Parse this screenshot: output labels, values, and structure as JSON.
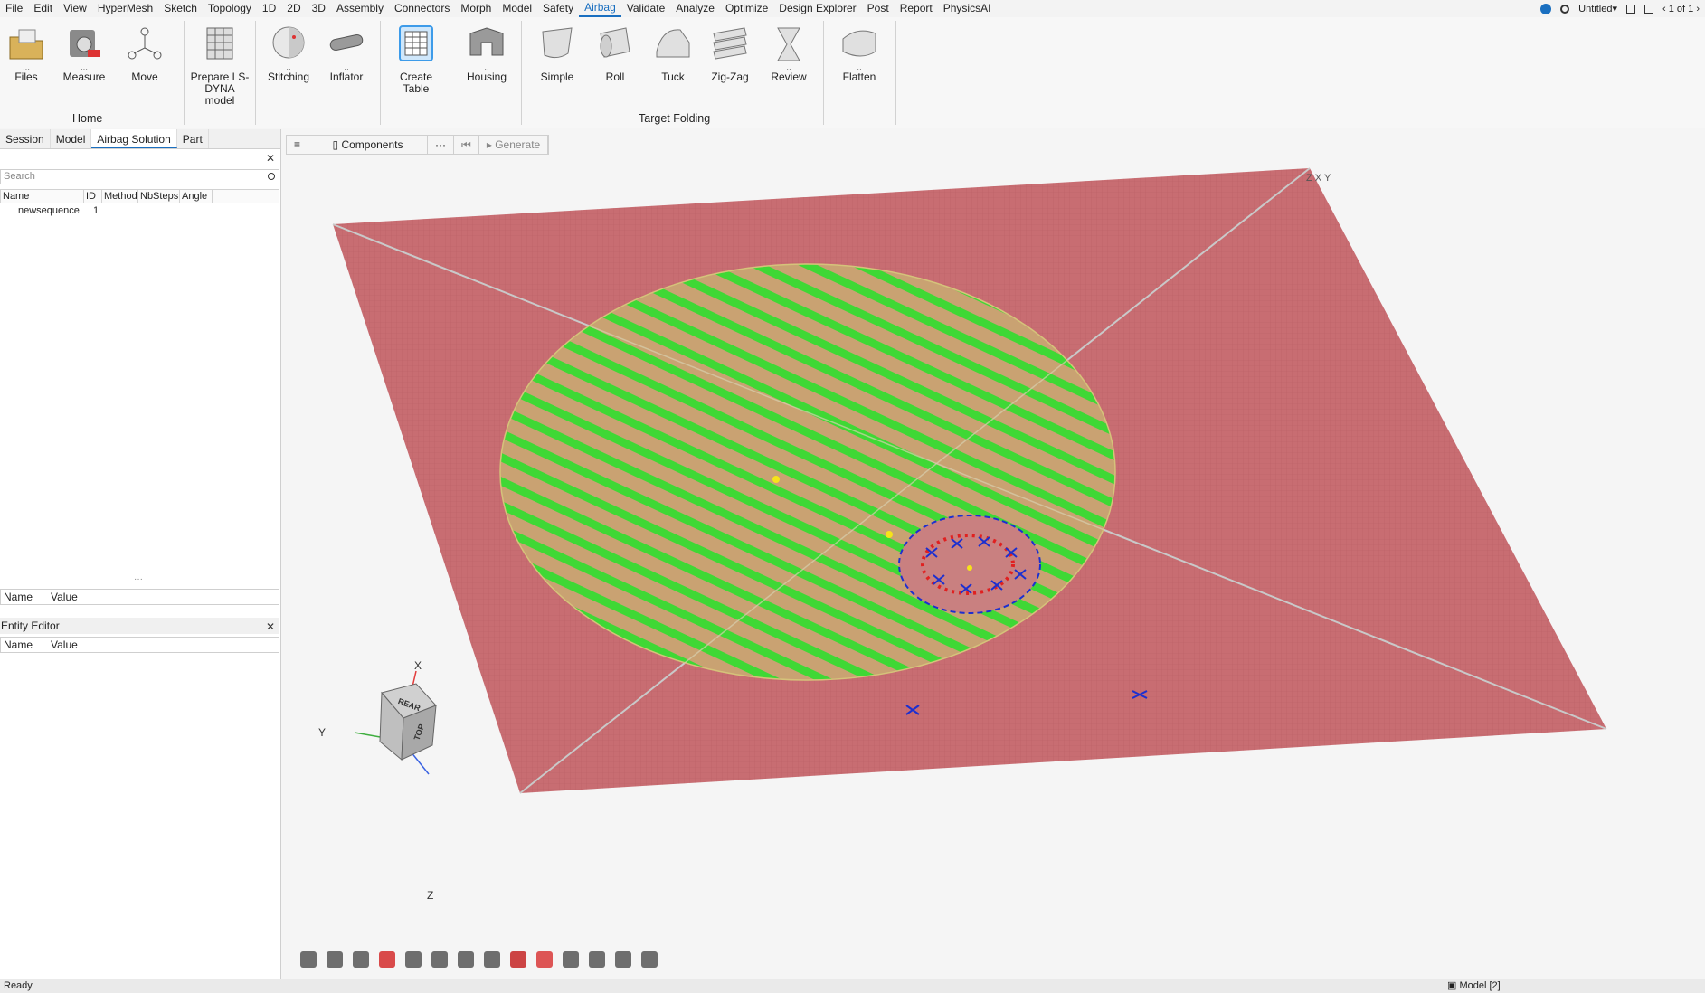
{
  "menu": {
    "items": [
      "File",
      "Edit",
      "View",
      "HyperMesh",
      "Sketch",
      "Topology",
      "1D",
      "2D",
      "3D",
      "Assembly",
      "Connectors",
      "Morph",
      "Model",
      "Safety",
      "Airbag",
      "Validate",
      "Analyze",
      "Optimize",
      "Design Explorer",
      "Post",
      "Report",
      "PhysicsAI"
    ],
    "active": "Airbag",
    "file_name": "Untitled",
    "page_indicator": "1 of 1"
  },
  "ribbon": {
    "buttons": [
      {
        "label": "Files",
        "icon": "folder-icon"
      },
      {
        "label": "Measure",
        "icon": "measure-icon"
      },
      {
        "label": "Move",
        "icon": "move-icon"
      },
      {
        "label": "Prepare LS-DYNA model",
        "icon": "grid-icon"
      },
      {
        "label": "Stitching",
        "icon": "sphere-icon"
      },
      {
        "label": "Inflator",
        "icon": "cylinder-icon"
      },
      {
        "label": "Create Table",
        "icon": "table-icon"
      },
      {
        "label": "Housing",
        "icon": "housing-icon"
      },
      {
        "label": "Simple",
        "icon": "simple-fold-icon"
      },
      {
        "label": "Roll",
        "icon": "roll-fold-icon"
      },
      {
        "label": "Tuck",
        "icon": "tuck-fold-icon"
      },
      {
        "label": "Zig-Zag",
        "icon": "zigzag-fold-icon"
      },
      {
        "label": "Review",
        "icon": "review-icon"
      },
      {
        "label": "Flatten",
        "icon": "flatten-icon"
      }
    ],
    "groups": {
      "home": "Home",
      "target_folding": "Target Folding"
    }
  },
  "left_panel": {
    "tabs": [
      "Session",
      "Model",
      "Airbag Solution",
      "Part"
    ],
    "active_tab": "Airbag Solution",
    "search_placeholder": "Search",
    "columns": [
      "Name",
      "ID",
      "Method",
      "NbSteps",
      "Angle"
    ],
    "rows": [
      {
        "name": "newsequence",
        "id": "1"
      }
    ],
    "props_columns": [
      "Name",
      "Value"
    ],
    "entity_editor_title": "Entity Editor",
    "entity_columns": [
      "Name",
      "Value"
    ]
  },
  "view_toolbar": {
    "components_label": "Components",
    "more_label": "···",
    "generate_label": "Generate"
  },
  "viewport": {
    "plane_color": "#c86d72",
    "airbag_color": "#c8a070",
    "mesh_green": "#36d630",
    "axis_labels": {
      "x": "X",
      "y": "Y",
      "z": "Z"
    },
    "corner_axes": "Z X Y",
    "cube_faces": {
      "top": "TOP",
      "rear": "REAR"
    }
  },
  "status": {
    "text": "Ready",
    "model": "Model [2]"
  }
}
